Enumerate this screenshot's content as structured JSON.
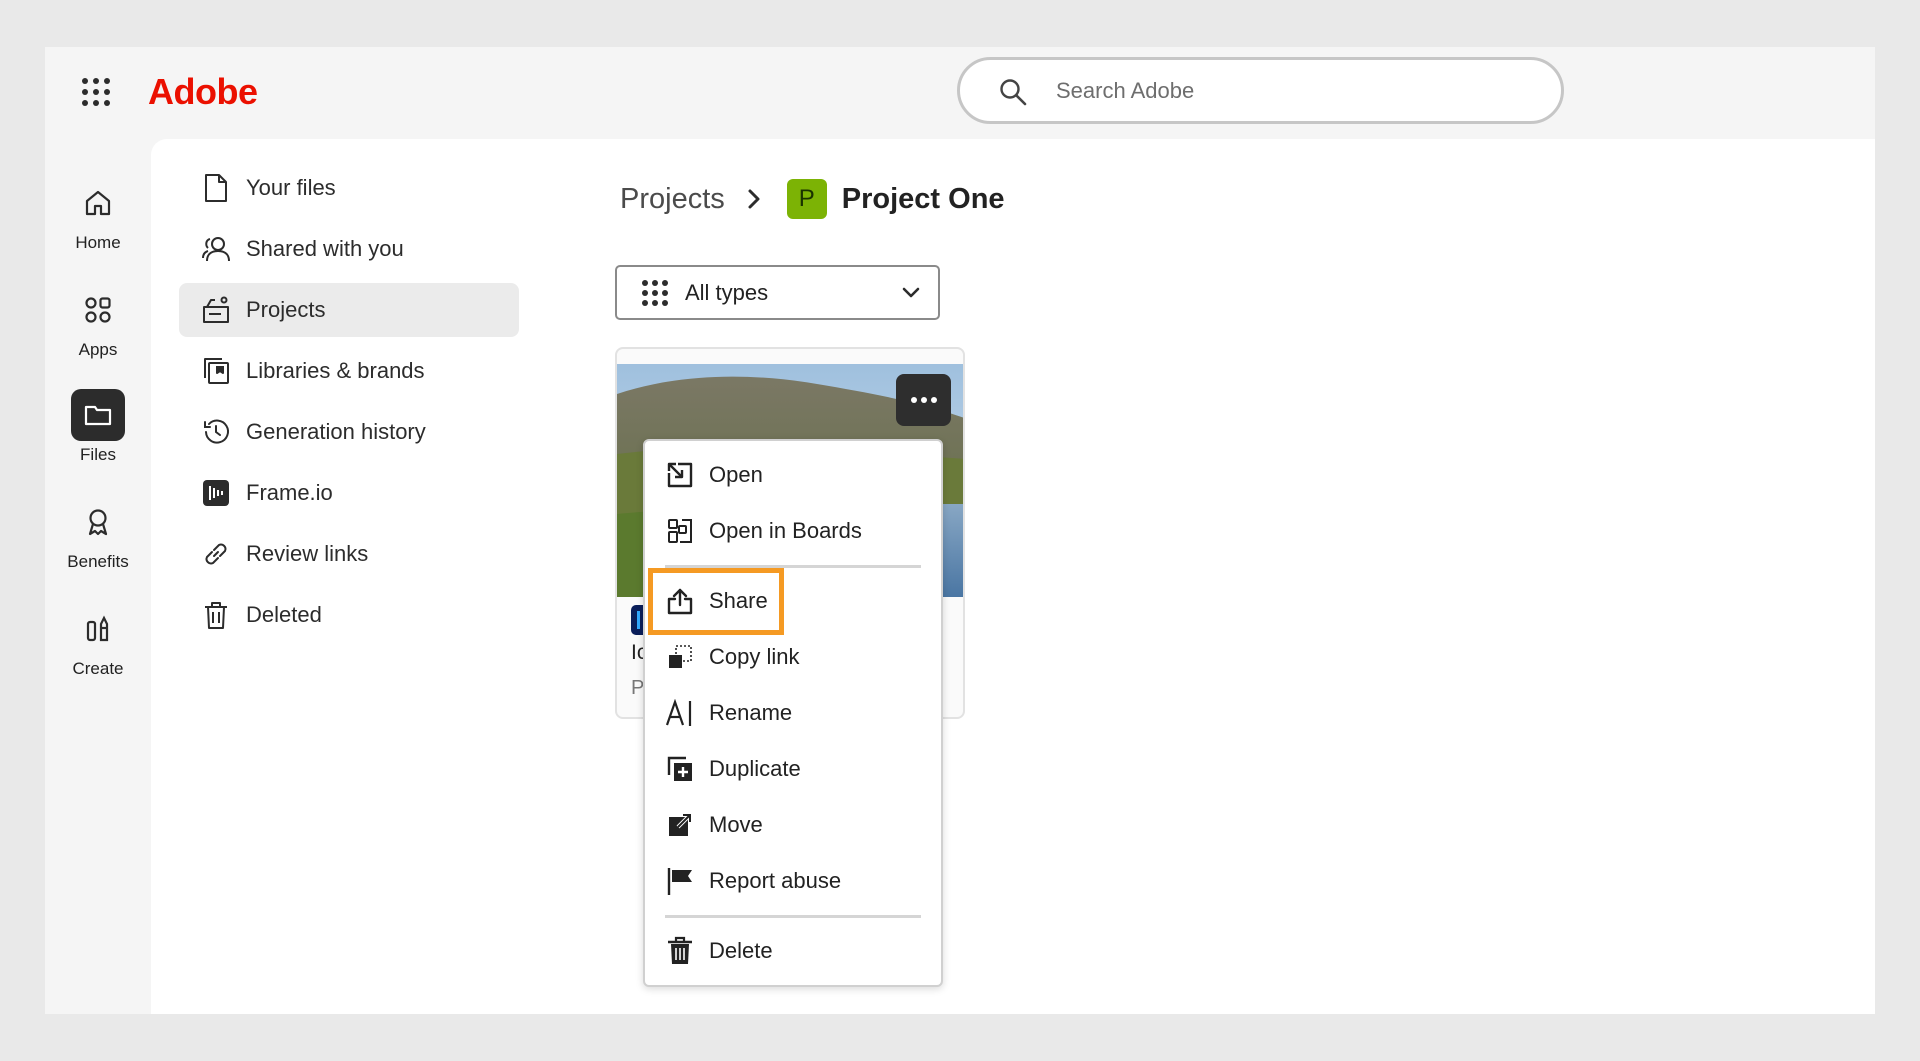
{
  "header": {
    "app_launcher_icon": "waffle-grid-icon",
    "logo": "Adobe",
    "logo_color": "#eb1000",
    "search": {
      "placeholder": "Search Adobe",
      "value": "",
      "icon": "search-icon"
    }
  },
  "rail": {
    "items": [
      {
        "label": "Home",
        "icon": "home-icon",
        "active": false
      },
      {
        "label": "Apps",
        "icon": "apps-icon",
        "active": false
      },
      {
        "label": "Files",
        "icon": "folder-icon",
        "active": true
      },
      {
        "label": "Benefits",
        "icon": "ribbon-icon",
        "active": false
      },
      {
        "label": "Create",
        "icon": "create-icon",
        "active": false
      }
    ]
  },
  "sidebar": {
    "items": [
      {
        "label": "Your files",
        "icon": "file-icon"
      },
      {
        "label": "Shared with you",
        "icon": "shared-users-icon"
      },
      {
        "label": "Projects",
        "icon": "projects-icon",
        "active": true
      },
      {
        "label": "Libraries & brands",
        "icon": "libraries-icon"
      },
      {
        "label": "Generation history",
        "icon": "history-icon"
      },
      {
        "label": "Frame.io",
        "icon": "frameio-icon"
      },
      {
        "label": "Review links",
        "icon": "link-icon"
      },
      {
        "label": "Deleted",
        "icon": "trash-icon"
      }
    ]
  },
  "breadcrumb": {
    "parent": "Projects",
    "project_initial": "P",
    "project_badge_color": "#7cb305",
    "project_name": "Project One"
  },
  "filter": {
    "label": "All types",
    "icon": "grid-icon"
  },
  "card": {
    "title_partial": "Ic",
    "subtitle_partial": "P",
    "more_icon": "more-horizontal-icon"
  },
  "context_menu": {
    "items": [
      {
        "label": "Open",
        "icon": "open-icon"
      },
      {
        "label": "Open in Boards",
        "icon": "boards-icon"
      },
      {
        "label": "Share",
        "icon": "share-icon",
        "highlighted": true
      },
      {
        "label": "Copy link",
        "icon": "copy-link-icon"
      },
      {
        "label": "Rename",
        "icon": "rename-icon"
      },
      {
        "label": "Duplicate",
        "icon": "duplicate-icon"
      },
      {
        "label": "Move",
        "icon": "move-icon"
      },
      {
        "label": "Report abuse",
        "icon": "flag-icon"
      },
      {
        "label": "Delete",
        "icon": "delete-icon"
      }
    ],
    "highlight_color": "#f59a23"
  }
}
